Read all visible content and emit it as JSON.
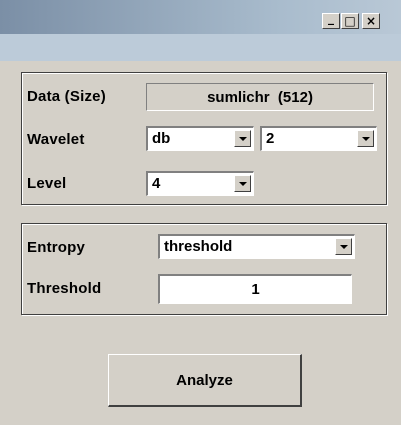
{
  "window": {
    "controls": {
      "minimize": "_",
      "maximize": "□",
      "close": "×"
    }
  },
  "data_panel": {
    "data_label": "Data (Size)",
    "data_value": "sumlichr  (512)",
    "wavelet_label": "Wavelet",
    "wavelet_family": "db",
    "wavelet_number": "2",
    "level_label": "Level",
    "level_value": "4"
  },
  "entropy_panel": {
    "entropy_label": "Entropy",
    "entropy_value": "threshold",
    "threshold_label": "Threshold",
    "threshold_value": "1"
  },
  "actions": {
    "analyze_label": "Analyze"
  },
  "colors": {
    "face": "#d4d0c8",
    "titlebar_start": "#7b8fa6",
    "titlebar_end": "#b9c8d6"
  }
}
